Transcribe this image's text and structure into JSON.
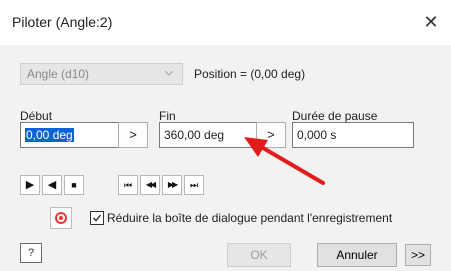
{
  "window": {
    "title": "Piloter (Angle:2)",
    "close_glyph": "✕"
  },
  "angle": {
    "selected": "Angle (d10)",
    "position_text": "Position = (0,00 deg)"
  },
  "debut": {
    "label": "Début",
    "value": "0,00 deg",
    "spin_glyph": ">"
  },
  "fin": {
    "label": "Fin",
    "value": "360,00 deg",
    "spin_glyph": ">"
  },
  "pause": {
    "label": "Durée de pause",
    "value": "0,000 s"
  },
  "playback": {
    "buttons": [
      {
        "name": "play-forward",
        "glyph": "▶"
      },
      {
        "name": "play-reverse",
        "glyph": "◀"
      },
      {
        "name": "stop",
        "glyph": "■"
      },
      {
        "name": "go-to-start",
        "glyph": "⏮"
      },
      {
        "name": "step-back",
        "glyph": "◀◀"
      },
      {
        "name": "step-forward",
        "glyph": "▶▶"
      },
      {
        "name": "go-to-end",
        "glyph": "⏭"
      }
    ]
  },
  "record": {
    "checkbox_checked": true,
    "checkbox_label": "Réduire la boîte de dialogue pendant l'enregistrement"
  },
  "footer": {
    "help_glyph": "?",
    "ok_label": "OK",
    "cancel_label": "Annuler",
    "more_label": ">>"
  },
  "colors": {
    "record_red": "#e53935",
    "selection_blue": "#0a64d8",
    "arrow_red": "#e21b1b"
  }
}
